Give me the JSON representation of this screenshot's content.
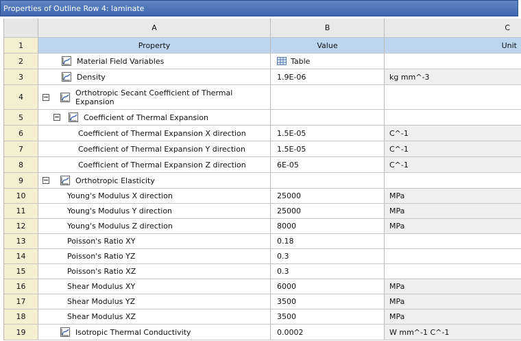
{
  "window": {
    "title": "Properties of Outline Row 4: laminate"
  },
  "columns": {
    "a": "A",
    "b": "B",
    "c": "C"
  },
  "header_row": {
    "num": "1",
    "property": "Property",
    "value": "Value",
    "unit": "Unit"
  },
  "rows": [
    {
      "num": "2",
      "property": "Material Field Variables",
      "value": "Table",
      "unit": ""
    },
    {
      "num": "3",
      "property": "Density",
      "value": "1.9E-06",
      "unit": "kg mm^-3"
    },
    {
      "num": "4",
      "property": "Orthotropic Secant Coefficient of Thermal Expansion",
      "value": "",
      "unit": ""
    },
    {
      "num": "5",
      "property": "Coefficient of Thermal Expansion",
      "value": "",
      "unit": ""
    },
    {
      "num": "6",
      "property": "Coefficient of Thermal Expansion X direction",
      "value": "1.5E-05",
      "unit": "C^-1"
    },
    {
      "num": "7",
      "property": "Coefficient of Thermal Expansion Y direction",
      "value": "1.5E-05",
      "unit": "C^-1"
    },
    {
      "num": "8",
      "property": "Coefficient of Thermal Expansion Z direction",
      "value": "6E-05",
      "unit": "C^-1"
    },
    {
      "num": "9",
      "property": "Orthotropic Elasticity",
      "value": "",
      "unit": ""
    },
    {
      "num": "10",
      "property": "Young's Modulus X direction",
      "value": "25000",
      "unit": "MPa"
    },
    {
      "num": "11",
      "property": "Young's Modulus Y direction",
      "value": "25000",
      "unit": "MPa"
    },
    {
      "num": "12",
      "property": "Young's Modulus Z direction",
      "value": "8000",
      "unit": "MPa"
    },
    {
      "num": "13",
      "property": "Poisson's Ratio XY",
      "value": "0.18",
      "unit": ""
    },
    {
      "num": "14",
      "property": "Poisson's Ratio YZ",
      "value": "0.3",
      "unit": ""
    },
    {
      "num": "15",
      "property": "Poisson's Ratio XZ",
      "value": "0.3",
      "unit": ""
    },
    {
      "num": "16",
      "property": "Shear Modulus XY",
      "value": "6000",
      "unit": "MPa"
    },
    {
      "num": "17",
      "property": "Shear Modulus YZ",
      "value": "3500",
      "unit": "MPa"
    },
    {
      "num": "18",
      "property": "Shear Modulus XZ",
      "value": "3500",
      "unit": "MPa"
    },
    {
      "num": "19",
      "property": "Isotropic Thermal Conductivity",
      "value": "0.0002",
      "unit": "W mm^-1 C^-1"
    }
  ],
  "icons": {
    "curve": "curve-chart-icon",
    "table": "table-icon",
    "expander": "collapse-icon"
  }
}
